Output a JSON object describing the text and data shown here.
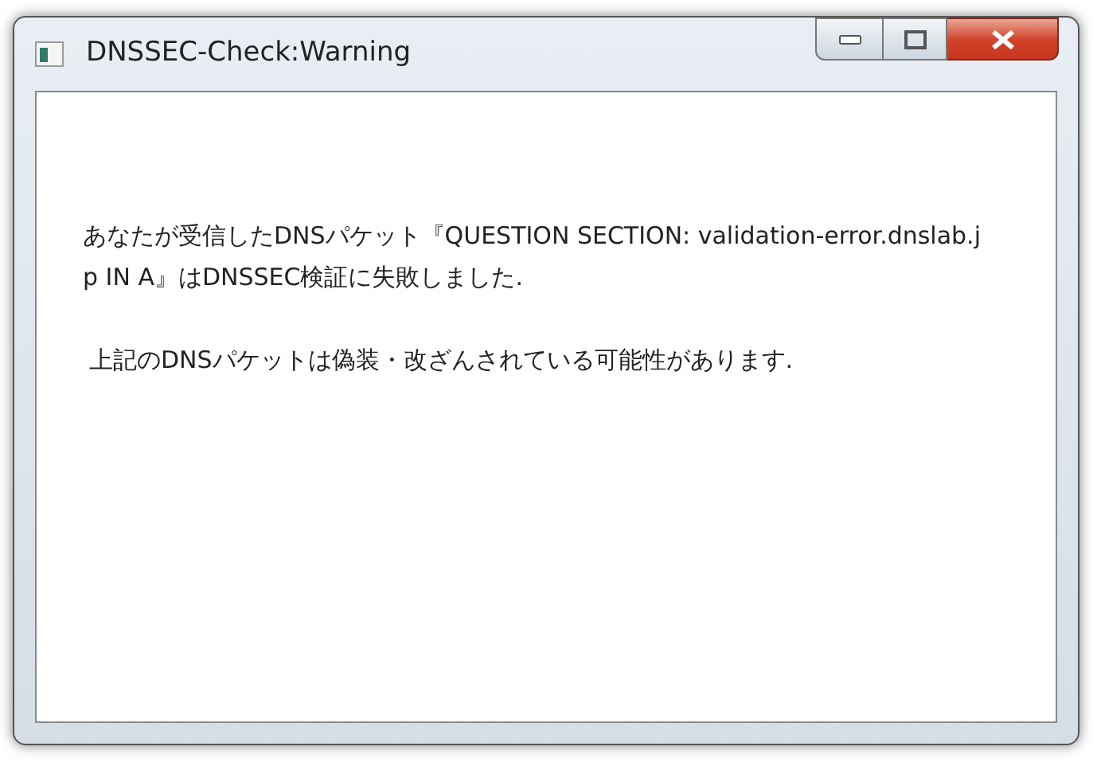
{
  "window": {
    "title": "DNSSEC-Check:Warning"
  },
  "messages": [
    "あなたが受信したDNSパケット『QUESTION SECTION: validation-error.dnslab.jp IN A』はDNSSEC検証に失敗しました.",
    "上記のDNSパケットは偽装・改ざんされている可能性があります."
  ]
}
